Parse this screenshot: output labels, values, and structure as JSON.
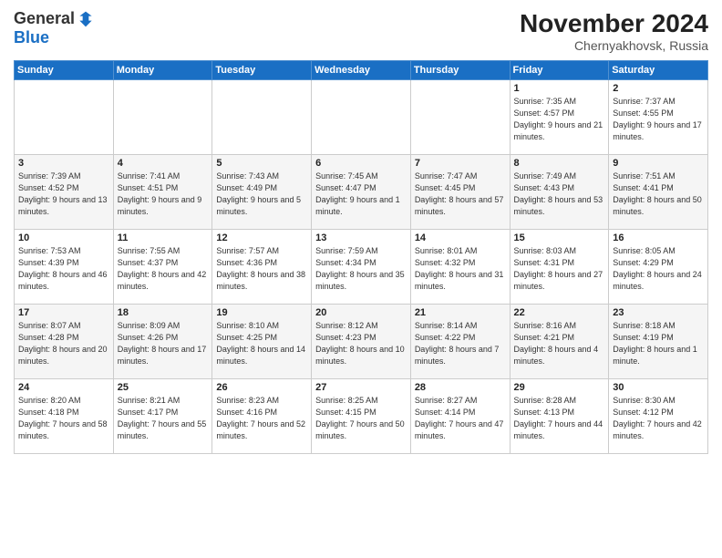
{
  "logo": {
    "general": "General",
    "blue": "Blue"
  },
  "header": {
    "month": "November 2024",
    "location": "Chernyakhovsk, Russia"
  },
  "weekdays": [
    "Sunday",
    "Monday",
    "Tuesday",
    "Wednesday",
    "Thursday",
    "Friday",
    "Saturday"
  ],
  "weeks": [
    [
      {
        "day": "",
        "info": ""
      },
      {
        "day": "",
        "info": ""
      },
      {
        "day": "",
        "info": ""
      },
      {
        "day": "",
        "info": ""
      },
      {
        "day": "",
        "info": ""
      },
      {
        "day": "1",
        "info": "Sunrise: 7:35 AM\nSunset: 4:57 PM\nDaylight: 9 hours and 21 minutes."
      },
      {
        "day": "2",
        "info": "Sunrise: 7:37 AM\nSunset: 4:55 PM\nDaylight: 9 hours and 17 minutes."
      }
    ],
    [
      {
        "day": "3",
        "info": "Sunrise: 7:39 AM\nSunset: 4:52 PM\nDaylight: 9 hours and 13 minutes."
      },
      {
        "day": "4",
        "info": "Sunrise: 7:41 AM\nSunset: 4:51 PM\nDaylight: 9 hours and 9 minutes."
      },
      {
        "day": "5",
        "info": "Sunrise: 7:43 AM\nSunset: 4:49 PM\nDaylight: 9 hours and 5 minutes."
      },
      {
        "day": "6",
        "info": "Sunrise: 7:45 AM\nSunset: 4:47 PM\nDaylight: 9 hours and 1 minute."
      },
      {
        "day": "7",
        "info": "Sunrise: 7:47 AM\nSunset: 4:45 PM\nDaylight: 8 hours and 57 minutes."
      },
      {
        "day": "8",
        "info": "Sunrise: 7:49 AM\nSunset: 4:43 PM\nDaylight: 8 hours and 53 minutes."
      },
      {
        "day": "9",
        "info": "Sunrise: 7:51 AM\nSunset: 4:41 PM\nDaylight: 8 hours and 50 minutes."
      }
    ],
    [
      {
        "day": "10",
        "info": "Sunrise: 7:53 AM\nSunset: 4:39 PM\nDaylight: 8 hours and 46 minutes."
      },
      {
        "day": "11",
        "info": "Sunrise: 7:55 AM\nSunset: 4:37 PM\nDaylight: 8 hours and 42 minutes."
      },
      {
        "day": "12",
        "info": "Sunrise: 7:57 AM\nSunset: 4:36 PM\nDaylight: 8 hours and 38 minutes."
      },
      {
        "day": "13",
        "info": "Sunrise: 7:59 AM\nSunset: 4:34 PM\nDaylight: 8 hours and 35 minutes."
      },
      {
        "day": "14",
        "info": "Sunrise: 8:01 AM\nSunset: 4:32 PM\nDaylight: 8 hours and 31 minutes."
      },
      {
        "day": "15",
        "info": "Sunrise: 8:03 AM\nSunset: 4:31 PM\nDaylight: 8 hours and 27 minutes."
      },
      {
        "day": "16",
        "info": "Sunrise: 8:05 AM\nSunset: 4:29 PM\nDaylight: 8 hours and 24 minutes."
      }
    ],
    [
      {
        "day": "17",
        "info": "Sunrise: 8:07 AM\nSunset: 4:28 PM\nDaylight: 8 hours and 20 minutes."
      },
      {
        "day": "18",
        "info": "Sunrise: 8:09 AM\nSunset: 4:26 PM\nDaylight: 8 hours and 17 minutes."
      },
      {
        "day": "19",
        "info": "Sunrise: 8:10 AM\nSunset: 4:25 PM\nDaylight: 8 hours and 14 minutes."
      },
      {
        "day": "20",
        "info": "Sunrise: 8:12 AM\nSunset: 4:23 PM\nDaylight: 8 hours and 10 minutes."
      },
      {
        "day": "21",
        "info": "Sunrise: 8:14 AM\nSunset: 4:22 PM\nDaylight: 8 hours and 7 minutes."
      },
      {
        "day": "22",
        "info": "Sunrise: 8:16 AM\nSunset: 4:21 PM\nDaylight: 8 hours and 4 minutes."
      },
      {
        "day": "23",
        "info": "Sunrise: 8:18 AM\nSunset: 4:19 PM\nDaylight: 8 hours and 1 minute."
      }
    ],
    [
      {
        "day": "24",
        "info": "Sunrise: 8:20 AM\nSunset: 4:18 PM\nDaylight: 7 hours and 58 minutes."
      },
      {
        "day": "25",
        "info": "Sunrise: 8:21 AM\nSunset: 4:17 PM\nDaylight: 7 hours and 55 minutes."
      },
      {
        "day": "26",
        "info": "Sunrise: 8:23 AM\nSunset: 4:16 PM\nDaylight: 7 hours and 52 minutes."
      },
      {
        "day": "27",
        "info": "Sunrise: 8:25 AM\nSunset: 4:15 PM\nDaylight: 7 hours and 50 minutes."
      },
      {
        "day": "28",
        "info": "Sunrise: 8:27 AM\nSunset: 4:14 PM\nDaylight: 7 hours and 47 minutes."
      },
      {
        "day": "29",
        "info": "Sunrise: 8:28 AM\nSunset: 4:13 PM\nDaylight: 7 hours and 44 minutes."
      },
      {
        "day": "30",
        "info": "Sunrise: 8:30 AM\nSunset: 4:12 PM\nDaylight: 7 hours and 42 minutes."
      }
    ]
  ]
}
